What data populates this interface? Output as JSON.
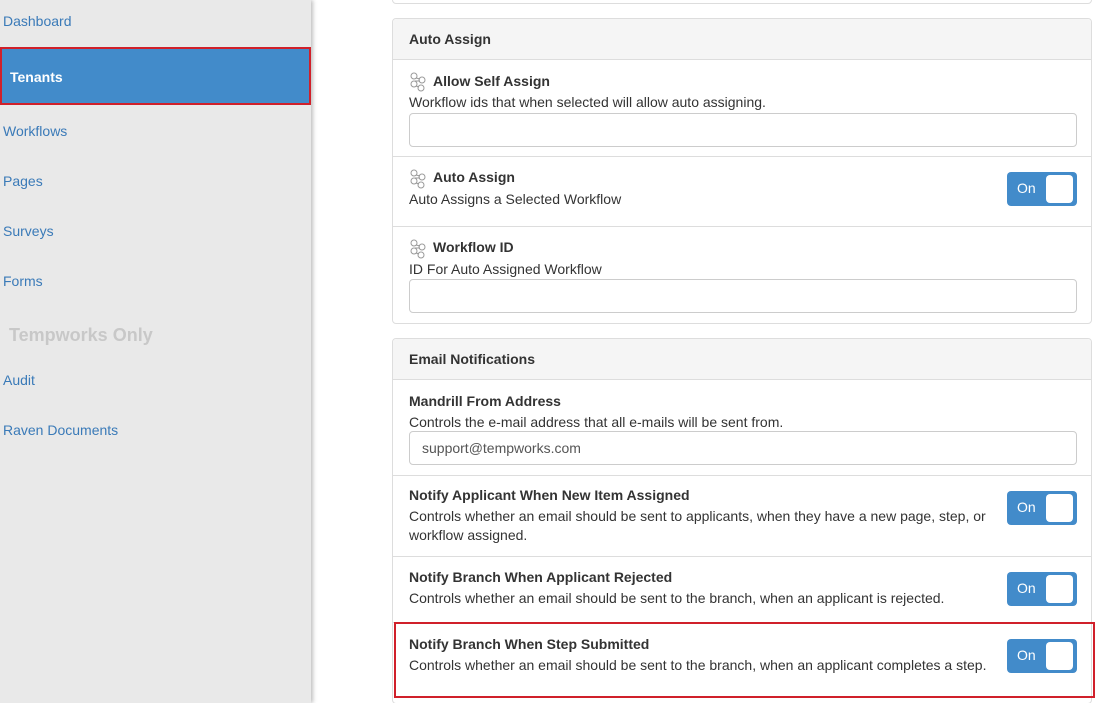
{
  "sidebar": {
    "items": [
      {
        "label": "Dashboard"
      },
      {
        "label": "Tenants"
      },
      {
        "label": "Workflows"
      },
      {
        "label": "Pages"
      },
      {
        "label": "Surveys"
      },
      {
        "label": "Forms"
      },
      {
        "label": "Audit"
      },
      {
        "label": "Raven Documents"
      }
    ],
    "heading": "Tempworks Only"
  },
  "auto_assign": {
    "title": "Auto Assign",
    "rows": [
      {
        "title": "Allow Self Assign",
        "desc": "Workflow ids that when selected will allow auto assigning.",
        "value": ""
      },
      {
        "title": "Auto Assign",
        "desc": "Auto Assigns a Selected Workflow",
        "toggle": "On"
      },
      {
        "title": "Workflow ID",
        "desc": "ID For Auto Assigned Workflow",
        "value": ""
      }
    ]
  },
  "email_notifications": {
    "title": "Email Notifications",
    "rows": [
      {
        "title": "Mandrill From Address",
        "desc": "Controls the e-mail address that all e-mails will be sent from.",
        "value": "support@tempworks.com"
      },
      {
        "title": "Notify Applicant When New Item Assigned",
        "desc_line1": "Controls whether an email should be sent to applicants, when they have a new page, step, or",
        "desc_line2": "workflow assigned.",
        "toggle": "On"
      },
      {
        "title": "Notify Branch When Applicant Rejected",
        "desc": "Controls whether an email should be sent to the branch, when an applicant is rejected.",
        "toggle": "On"
      },
      {
        "title": "Notify Branch When Step Submitted",
        "desc": "Controls whether an email should be sent to the branch, when an applicant completes a step.",
        "toggle": "On"
      }
    ]
  },
  "colors": {
    "accent": "#428bca",
    "highlight": "#d0202a",
    "link": "#3a7ab8"
  }
}
